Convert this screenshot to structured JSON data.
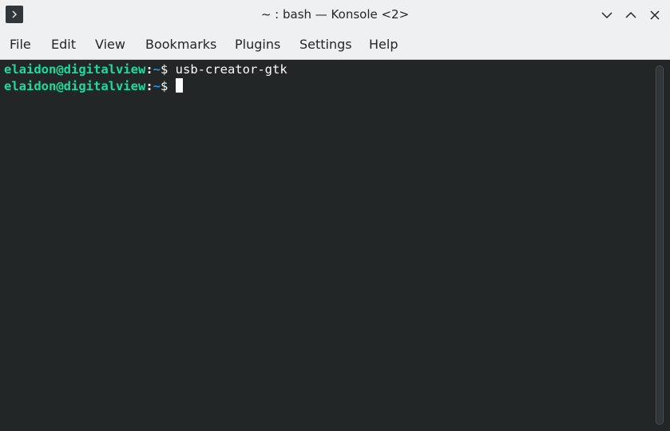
{
  "window": {
    "title": "~ : bash — Konsole <2>",
    "icon": "terminal-chevron-icon",
    "buttons": [
      "minimize-icon",
      "maximize-icon",
      "close-icon"
    ]
  },
  "menubar": {
    "items": [
      {
        "label": "File"
      },
      {
        "label": "Edit"
      },
      {
        "label": "View"
      },
      {
        "label": "Bookmarks"
      },
      {
        "label": "Plugins"
      },
      {
        "label": "Settings"
      },
      {
        "label": "Help"
      }
    ]
  },
  "terminal": {
    "lines": [
      {
        "user_host": "elaidon@digitalview",
        "colon": ":",
        "path": "~",
        "symbol": "$ ",
        "command": "usb-creator-gtk"
      },
      {
        "user_host": "elaidon@digitalview",
        "colon": ":",
        "path": "~",
        "symbol": "$ ",
        "command": ""
      }
    ]
  },
  "colors": {
    "titlebar_bg": "#eff0f1",
    "terminal_bg": "#232627",
    "prompt_user": "#1cdc9a",
    "prompt_path": "#1d99f3",
    "text": "#fcfcfc"
  }
}
